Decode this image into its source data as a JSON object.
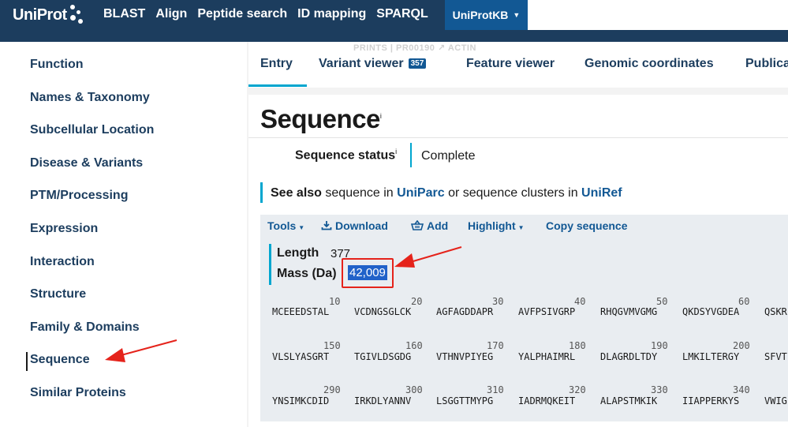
{
  "header": {
    "logo": "UniProt",
    "nav": [
      "BLAST",
      "Align",
      "Peptide search",
      "ID mapping",
      "SPARQL"
    ],
    "database_selector": "UniProtKB"
  },
  "sidebar": {
    "items": [
      "Function",
      "Names & Taxonomy",
      "Subcellular Location",
      "Disease & Variants",
      "PTM/Processing",
      "Expression",
      "Interaction",
      "Structure",
      "Family & Domains",
      "Sequence",
      "Similar Proteins"
    ]
  },
  "faded_reference": "PRINTS  |  PR00190 ↗ ACTIN",
  "tabs": {
    "entry": "Entry",
    "variant_viewer": "Variant viewer",
    "variant_count": "357",
    "feature_viewer": "Feature viewer",
    "genomic_coordinates": "Genomic coordinates",
    "publications": "Publica"
  },
  "sequence": {
    "title": "Sequence",
    "info_marker": "i",
    "status_label": "Sequence status",
    "status_value": "Complete",
    "see_also_label": "See also",
    "see_also_text_1": "sequence in",
    "uniparc": "UniParc",
    "see_also_text_2": "or sequence clusters in",
    "uniref": "UniRef",
    "toolbar": {
      "tools": "Tools",
      "download": "Download",
      "add": "Add",
      "highlight": "Highlight",
      "copy": "Copy sequence"
    },
    "length_label": "Length",
    "length_value": "377",
    "mass_label": "Mass (Da)",
    "mass_value": "42,009",
    "rows": [
      {
        "positions": [
          "10",
          "20",
          "30",
          "40",
          "50",
          "60"
        ],
        "chunks": [
          "MCEEEDSTAL",
          "VCDNGSGLCK",
          "AGFAGDDAPR",
          "AVFPSIVGRP",
          "RHQGVMVGMG",
          "QKDSYVGDEA",
          "QSKR"
        ]
      },
      {
        "positions": [
          "150",
          "160",
          "170",
          "180",
          "190",
          "200"
        ],
        "chunks": [
          "VLSLYASGRT",
          "TGIVLDSGDG",
          "VTHNVPIYEG",
          "YALPHAIMRL",
          "DLAGRDLTDY",
          "LMKILTERGY",
          "SFVT"
        ]
      },
      {
        "positions": [
          "290",
          "300",
          "310",
          "320",
          "330",
          "340"
        ],
        "chunks": [
          "YNSIMKCDID",
          "IRKDLYANNV",
          "LSGGTTMYPG",
          "IADRMQKEIT",
          "ALAPSTMKIK",
          "IIAPPERKYS",
          "VWIG"
        ]
      }
    ]
  },
  "colors": {
    "header_bg": "#1c3d5e",
    "accent": "#00a6cf",
    "link": "#125894",
    "highlight_box": "#e5231b"
  }
}
